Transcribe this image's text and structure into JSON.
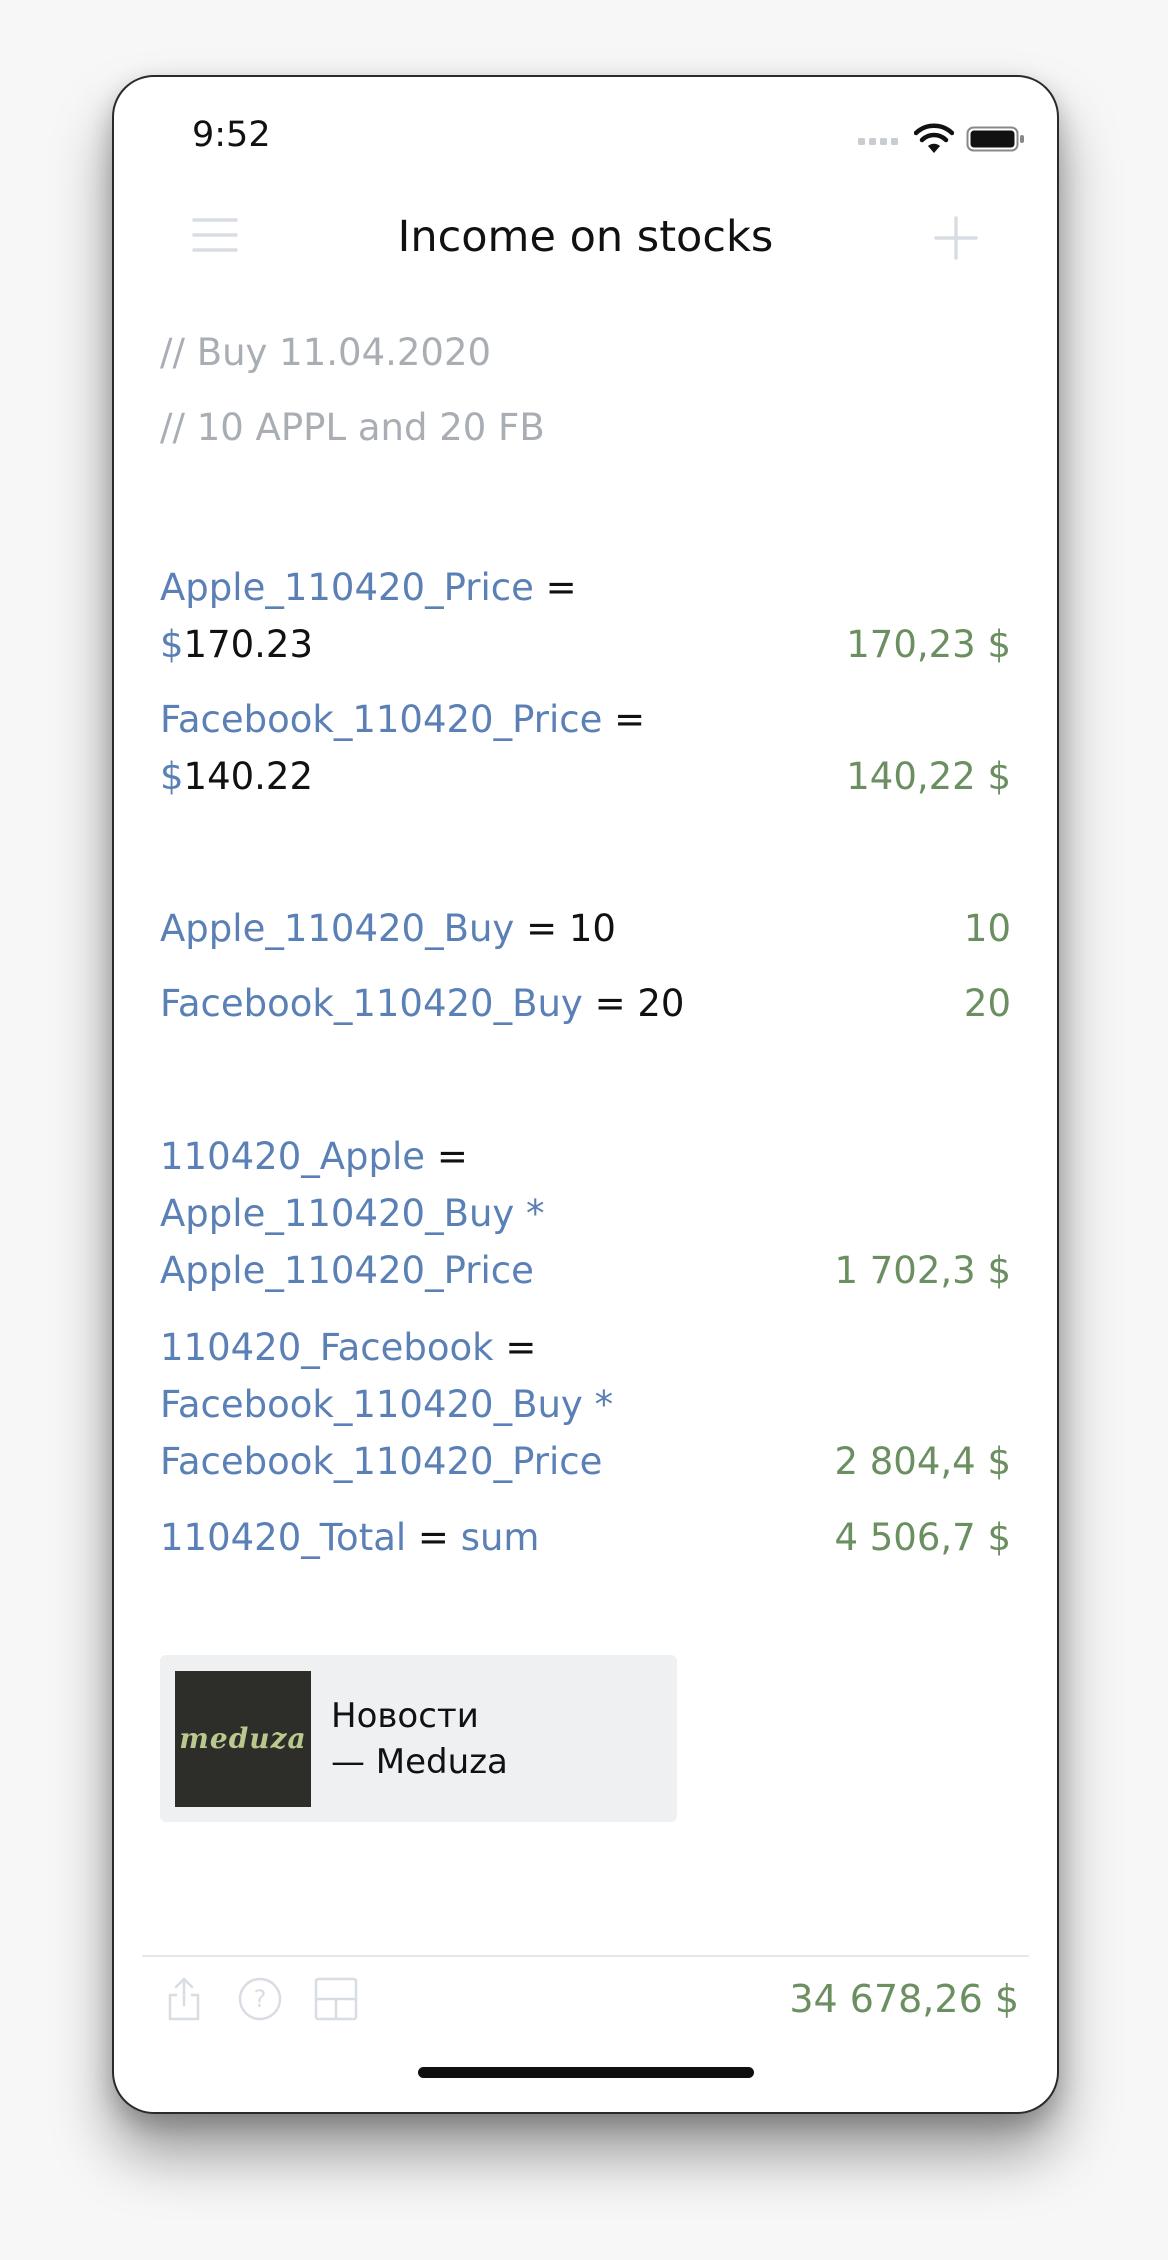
{
  "status_bar": {
    "time": "9:52"
  },
  "nav": {
    "title": "Income on stocks",
    "menu_icon": "menu-icon",
    "add_icon": "plus-icon"
  },
  "comments": [
    "// Buy 11.04.2020",
    "// 10 APPL and 20 FB"
  ],
  "lines": {
    "apple_price": {
      "var": "Apple_110420_Price",
      "op": " =",
      "prefix": "$",
      "value": "170.23",
      "result": "170,23 $"
    },
    "fb_price": {
      "var": "Facebook_110420_Price",
      "op": " =",
      "prefix": "$",
      "value": "140.22",
      "result": "140,22 $"
    },
    "apple_buy": {
      "var": "Apple_110420_Buy",
      "op": " = ",
      "value": "10",
      "result": "10"
    },
    "fb_buy": {
      "var": "Facebook_110420_Buy",
      "op": " = ",
      "value": "20",
      "result": "20"
    },
    "apple_total": {
      "var": "110420_Apple",
      "op": " =",
      "l2": "Apple_110420_Buy *",
      "l3": "Apple_110420_Price",
      "result": "1 702,3 $"
    },
    "fb_total": {
      "var": "110420_Facebook",
      "op": " =",
      "l2": "Facebook_110420_Buy *",
      "l3": "Facebook_110420_Price",
      "result": "2 804,4 $"
    },
    "total": {
      "var": "110420_Total",
      "op": " = ",
      "fn": "sum",
      "result": "4 506,7 $"
    }
  },
  "card": {
    "logo_text": "meduza",
    "title_line1": "Новости",
    "title_line2": "— Meduza"
  },
  "bottom_bar": {
    "icons": [
      "share-icon",
      "help-icon",
      "layout-icon"
    ],
    "total": "34 678,26 $"
  },
  "colors": {
    "variable": "#5b80b6",
    "result": "#6b8f60",
    "comment": "#a9aeb5",
    "icon": "#d8dde3"
  }
}
